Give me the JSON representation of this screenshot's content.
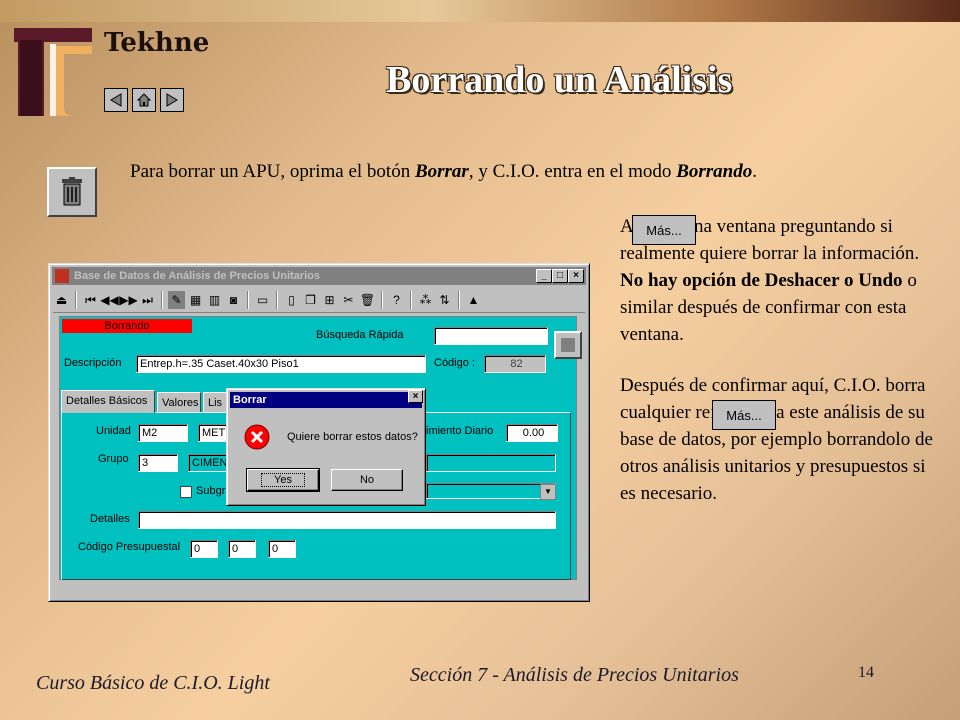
{
  "header": {
    "brand": "Tekhne",
    "title": "Borrando un Análisis",
    "nav": [
      "back-icon",
      "home-icon",
      "forward-icon"
    ]
  },
  "intro": {
    "part1": "Para borrar un APU, oprima el botón ",
    "borrar": "Borrar",
    "part2": ", y C.I.O. entra en el modo ",
    "borrando": "Borrando",
    "part3": "."
  },
  "right_column": {
    "p1_a": "A",
    "p1_b": " una ventana preguntando si realmente quiere borrar la información. ",
    "p1_bold": "No hay opción de Deshacer o Undo",
    "p1_c": " o similar después de confirmar con esta ventana.",
    "p2": "Después de confirmar aquí, C.I.O. borra cualquier referencia a este análisis de su base de datos, por ejemplo borrandolo de otros análisis unitarios y presupuestos si es necesario.",
    "mas1": "Más...",
    "mas2": "Más..."
  },
  "app": {
    "window_title": "Base de Datos de Análisis de Precios Unitarios",
    "window_buttons": [
      "_",
      "□",
      "×"
    ],
    "mode_banner": "Borrando",
    "busqueda_label": "Búsqueda Rápida",
    "busqueda_value": "",
    "descripcion_label": "Descripción",
    "descripcion_value": "Entrep.h=.35 Caset.40x30 Piso1",
    "codigo_label": "Código :",
    "codigo_value": "82",
    "tabs": [
      "Detalles Básicos",
      "Valores",
      "Lis"
    ],
    "unidad_label": "Unidad",
    "unidad_value": "M2",
    "unidad_desc": "METI",
    "rendimiento_label": "imiento Diario",
    "rendimiento_value": "0.00",
    "grupo_label": "Grupo",
    "grupo_value": "3",
    "grupo_desc": "CIMEN",
    "subgrupo_label": "Subgr",
    "detalles_label": "Detalles",
    "detalles_value": "",
    "codigo_presupuestal_label": "Código Presupuestal",
    "codigo_presupuestal_values": [
      "0",
      "0",
      "0"
    ]
  },
  "dialog": {
    "title": "Borrar",
    "close": "×",
    "message": "Quiere borrar estos datos?",
    "yes": "Yes",
    "no": "No"
  },
  "footer": {
    "left": "Curso Básico de C.I.O. Light",
    "section": "Sección 7 - Análisis de Precios Unitarios",
    "page": "14"
  }
}
